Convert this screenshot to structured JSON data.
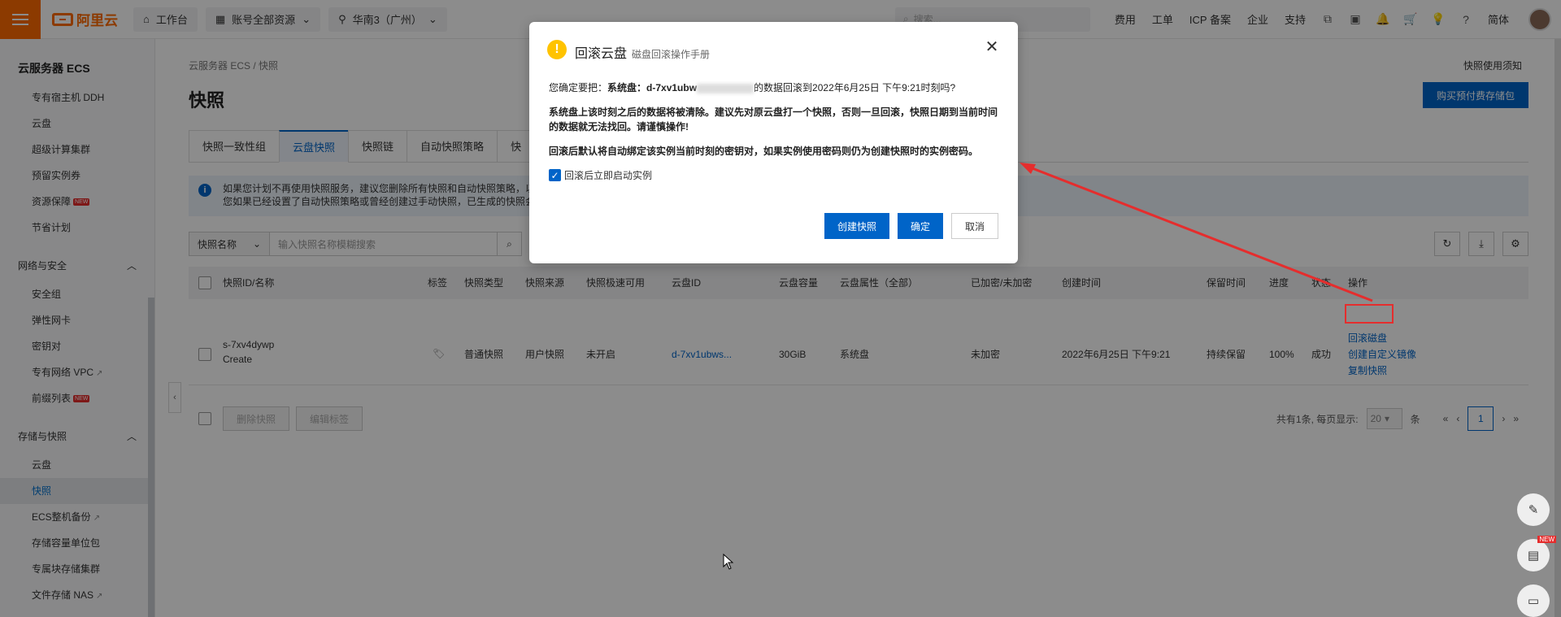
{
  "topbar": {
    "logo": "阿里云",
    "workbench": "工作台",
    "account_resources": "账号全部资源",
    "region": "华南3（广州）",
    "search_placeholder": "搜索...",
    "links": [
      "费用",
      "工单",
      "ICP 备案",
      "企业",
      "支持"
    ],
    "lang": "简体"
  },
  "sidebar": {
    "title": "云服务器 ECS",
    "items_top": [
      "专有宿主机 DDH",
      "云盘",
      "超级计算集群",
      "预留实例券",
      "资源保障",
      "节省计划"
    ],
    "group_network": "网络与安全",
    "items_network": [
      "安全组",
      "弹性网卡",
      "密钥对",
      "专有网络 VPC",
      "前缀列表"
    ],
    "group_storage": "存储与快照",
    "items_storage": [
      "云盘",
      "快照",
      "ECS整机备份",
      "存储容量单位包",
      "专属块存储集群",
      "文件存储 NAS"
    ],
    "new_badge": "NEW"
  },
  "main": {
    "breadcrumb": "云服务器 ECS  /  快照",
    "title": "快照",
    "help_link": "快照使用须知",
    "buy_button": "购买预付费存储包",
    "tabs": [
      "快照一致性组",
      "云盘快照",
      "快照链",
      "自动快照策略",
      "快"
    ],
    "notice_line1": "如果您计划不再使用快照服务，建议您删除所有快照和自动快照策略，以",
    "notice_line2": "您如果已经设置了自动快照策略或曾经创建过手动快照，已生成的快照会",
    "filter_select": "快照名称",
    "filter_placeholder": "输入快照名称模糊搜索",
    "columns": [
      "快照ID/名称",
      "标签",
      "快照类型",
      "快照来源",
      "快照极速可用",
      "云盘ID",
      "云盘容量",
      "云盘属性（全部）",
      "已加密/未加密",
      "创建时间",
      "保留时间",
      "进度",
      "状态",
      "操作"
    ],
    "row": {
      "id": "s-7xv4dywp",
      "name": "Create",
      "type": "普通快照",
      "source": "用户快照",
      "fast": "未开启",
      "disk_id": "d-7xv1ubws...",
      "capacity": "30GiB",
      "attr": "系统盘",
      "encrypted": "未加密",
      "created": "2022年6月25日 下午9:21",
      "retention": "持续保留",
      "progress": "100%",
      "status": "成功",
      "action1": "回滚磁盘",
      "action2": "创建自定义镜像",
      "action3": "复制快照"
    },
    "delete_button": "删除快照",
    "edit_tags_button": "编辑标签",
    "pager_total": "共有1条, 每页显示:",
    "pager_size": "20",
    "pager_unit": "条",
    "pager_page": "1"
  },
  "modal": {
    "title": "回滚云盘",
    "subtitle": "磁盘回滚操作手册",
    "line1_prefix": "您确定要把：",
    "line1_disk": "系统盘：d-7xv1ubw",
    "line1_suffix": "的数据回滚到2022年6月25日 下午9:21时刻吗?",
    "warning": "系统盘上该时刻之后的数据将被清除。建议先对原云盘打一个快照，否则一旦回滚，快照日期到当前时间的数据就无法找回。请谨慎操作!",
    "keypair": "回滚后默认将自动绑定该实例当前时刻的密钥对，如果实例使用密码则仍为创建快照时的实例密码。",
    "checkbox_label": "回滚后立即启动实例",
    "btn_create": "创建快照",
    "btn_ok": "确定",
    "btn_cancel": "取消"
  },
  "float": {
    "new_badge": "NEW"
  }
}
